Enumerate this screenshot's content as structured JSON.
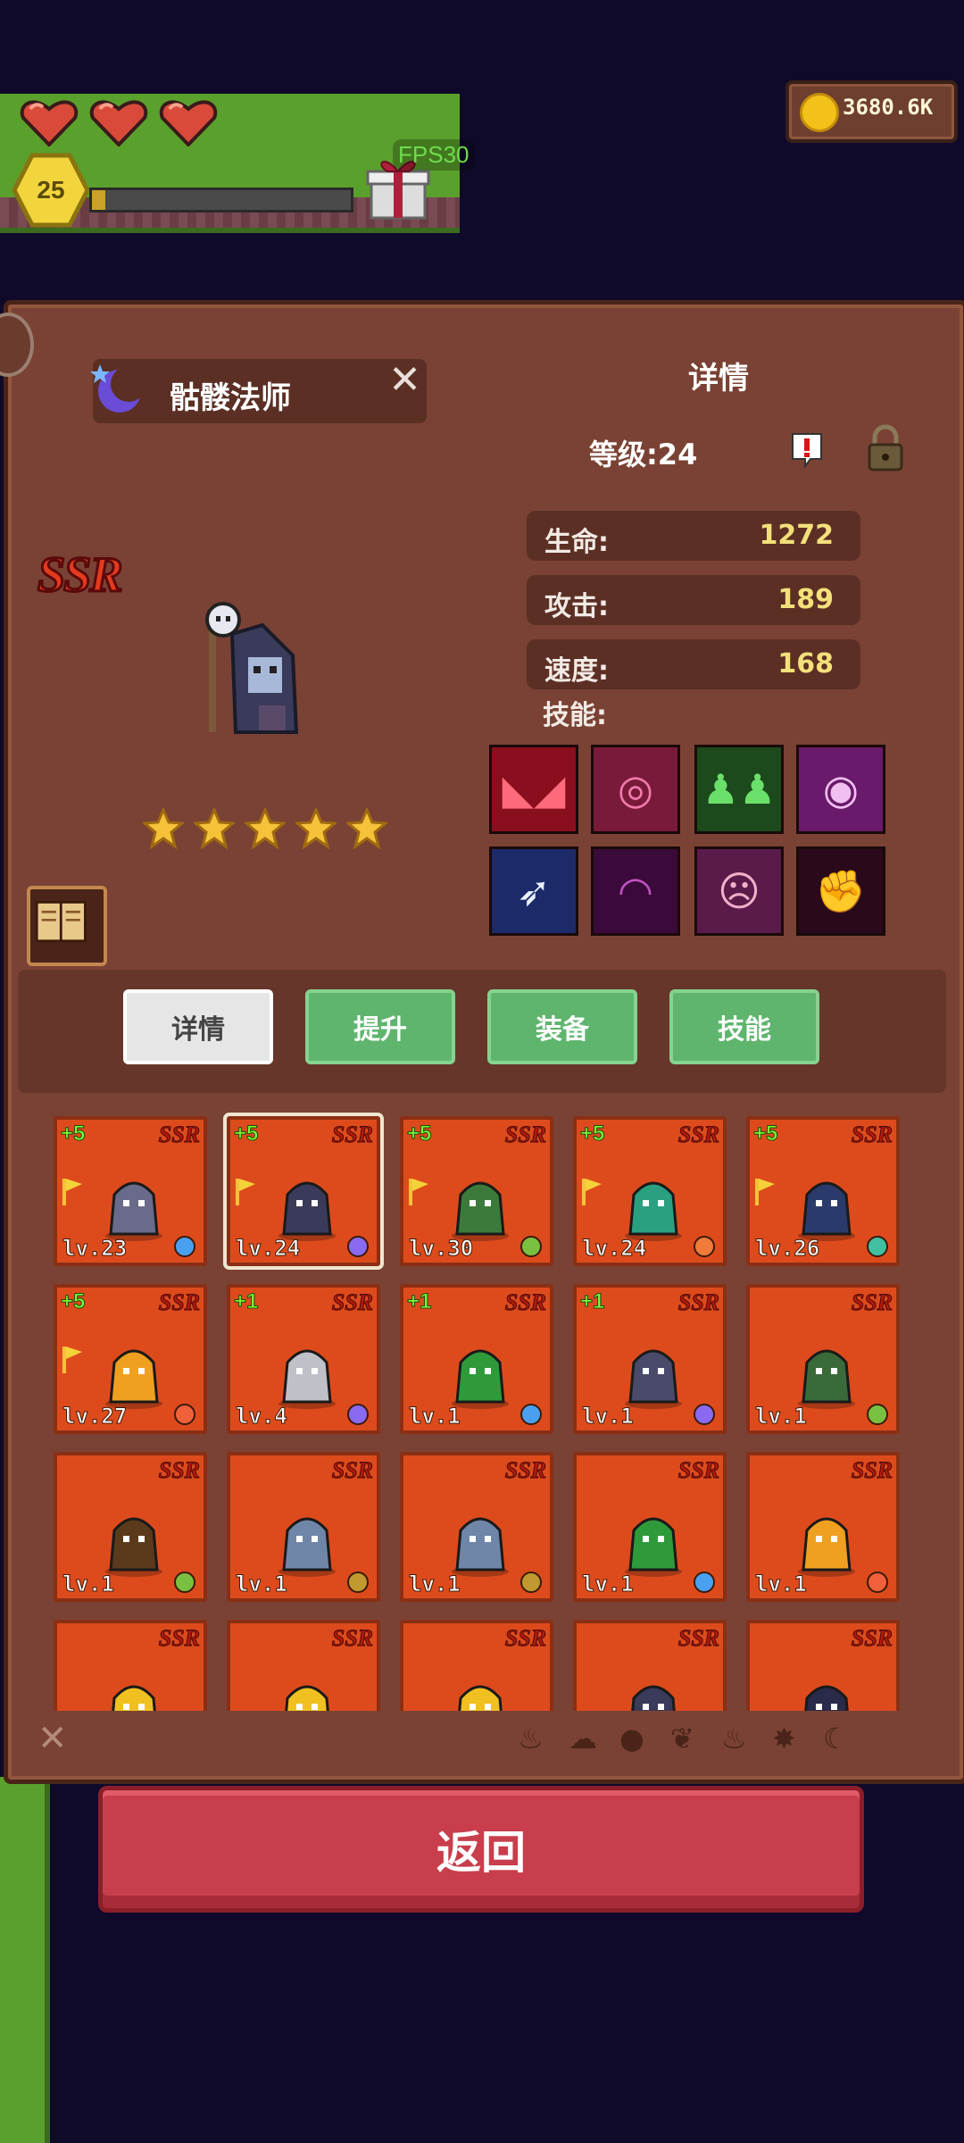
{
  "hud": {
    "hearts": 3,
    "player_level": "25",
    "xp_progress": 0.05,
    "fps_label": "FPS30",
    "coins": "3680.6K"
  },
  "panel": {
    "character_name": "骷髅法师",
    "detail_title": "详情",
    "level_text": "等级:24",
    "rarity": "SSR",
    "star_count": 5,
    "stats": [
      {
        "label": "生命:",
        "value": "1272"
      },
      {
        "label": "攻击:",
        "value": "189"
      },
      {
        "label": "速度:",
        "value": "168"
      }
    ],
    "skills_label": "技能:",
    "skills": [
      {
        "icon": "red-demon-face-icon",
        "color": "#8a0f1e"
      },
      {
        "icon": "pink-spiral-icon",
        "color": "#7a1a3a"
      },
      {
        "icon": "green-silhouettes-icon",
        "color": "#1c4a1c"
      },
      {
        "icon": "purple-eye-icon",
        "color": "#6a1a6a"
      },
      {
        "icon": "white-feather-icon",
        "color": "#1c2a6a"
      },
      {
        "icon": "dark-hood-icon",
        "color": "#3a0a3a"
      },
      {
        "icon": "pink-mask-icon",
        "color": "#5a1a4a"
      },
      {
        "icon": "red-fist-icon",
        "color": "#2a0a1a"
      }
    ]
  },
  "tabs": [
    {
      "label": "详情",
      "active": true
    },
    {
      "label": "提升",
      "active": false
    },
    {
      "label": "装备",
      "active": false
    },
    {
      "label": "技能",
      "active": false
    }
  ],
  "cards": [
    {
      "plus": "+5",
      "ssr": "SSR",
      "level": "lv.23",
      "flag": true,
      "monster": "skeleton-mage-rider",
      "element": "water"
    },
    {
      "plus": "+5",
      "ssr": "SSR",
      "level": "lv.24",
      "flag": true,
      "monster": "skeleton-mage",
      "element": "moon",
      "selected": true
    },
    {
      "plus": "+5",
      "ssr": "SSR",
      "level": "lv.30",
      "flag": true,
      "monster": "goblin",
      "element": "leaf"
    },
    {
      "plus": "+5",
      "ssr": "SSR",
      "level": "lv.24",
      "flag": true,
      "monster": "treant-beast",
      "element": "sun"
    },
    {
      "plus": "+5",
      "ssr": "SSR",
      "level": "lv.26",
      "flag": true,
      "monster": "eyeball-mage",
      "element": "wind"
    },
    {
      "plus": "+5",
      "ssr": "SSR",
      "level": "lv.27",
      "flag": true,
      "monster": "fire-elemental",
      "element": "fire"
    },
    {
      "plus": "+1",
      "ssr": "SSR",
      "level": "lv.4",
      "flag": false,
      "monster": "ghost-gunner",
      "element": "moon"
    },
    {
      "plus": "+1",
      "ssr": "SSR",
      "level": "lv.1",
      "flag": false,
      "monster": "green-ogre",
      "element": "water"
    },
    {
      "plus": "+1",
      "ssr": "SSR",
      "level": "lv.1",
      "flag": false,
      "monster": "skeleton-archer",
      "element": "moon"
    },
    {
      "plus": "",
      "ssr": "SSR",
      "level": "lv.1",
      "flag": false,
      "monster": "goblin-shaman",
      "element": "leaf"
    },
    {
      "plus": "",
      "ssr": "SSR",
      "level": "lv.1",
      "flag": false,
      "monster": "wood-golem",
      "element": "leaf"
    },
    {
      "plus": "",
      "ssr": "SSR",
      "level": "lv.1",
      "flag": false,
      "monster": "stone-golem",
      "element": "earth"
    },
    {
      "plus": "",
      "ssr": "SSR",
      "level": "lv.1",
      "flag": false,
      "monster": "stone-golem",
      "element": "earth"
    },
    {
      "plus": "",
      "ssr": "SSR",
      "level": "lv.1",
      "flag": false,
      "monster": "green-ogre",
      "element": "water"
    },
    {
      "plus": "",
      "ssr": "SSR",
      "level": "lv.1",
      "flag": false,
      "monster": "fire-elemental",
      "element": "fire"
    },
    {
      "plus": "",
      "ssr": "SSR",
      "level": "",
      "flag": false,
      "monster": "horned-demon",
      "element": ""
    },
    {
      "plus": "",
      "ssr": "SSR",
      "level": "",
      "flag": false,
      "monster": "horned-demon",
      "element": ""
    },
    {
      "plus": "",
      "ssr": "SSR",
      "level": "",
      "flag": false,
      "monster": "horned-demon",
      "element": ""
    },
    {
      "plus": "",
      "ssr": "SSR",
      "level": "",
      "flag": false,
      "monster": "dark-knight",
      "element": ""
    },
    {
      "plus": "",
      "ssr": "SSR",
      "level": "",
      "flag": false,
      "monster": "hooded-wraith",
      "element": ""
    }
  ],
  "filters": [
    "fire-filter-icon",
    "earth-filter-icon",
    "water-filter-icon",
    "leaf-filter-icon",
    "flame-filter-icon",
    "star-filter-icon",
    "moon-filter-icon"
  ],
  "back_button": "返回",
  "colors": {
    "panel": "#7a4234",
    "card": "#dd4b1c",
    "tab_active": "#e6e6e6",
    "tab_inactive": "#5fb56e",
    "back_button": "#c83e4c",
    "stat_value": "#f4e07a"
  }
}
